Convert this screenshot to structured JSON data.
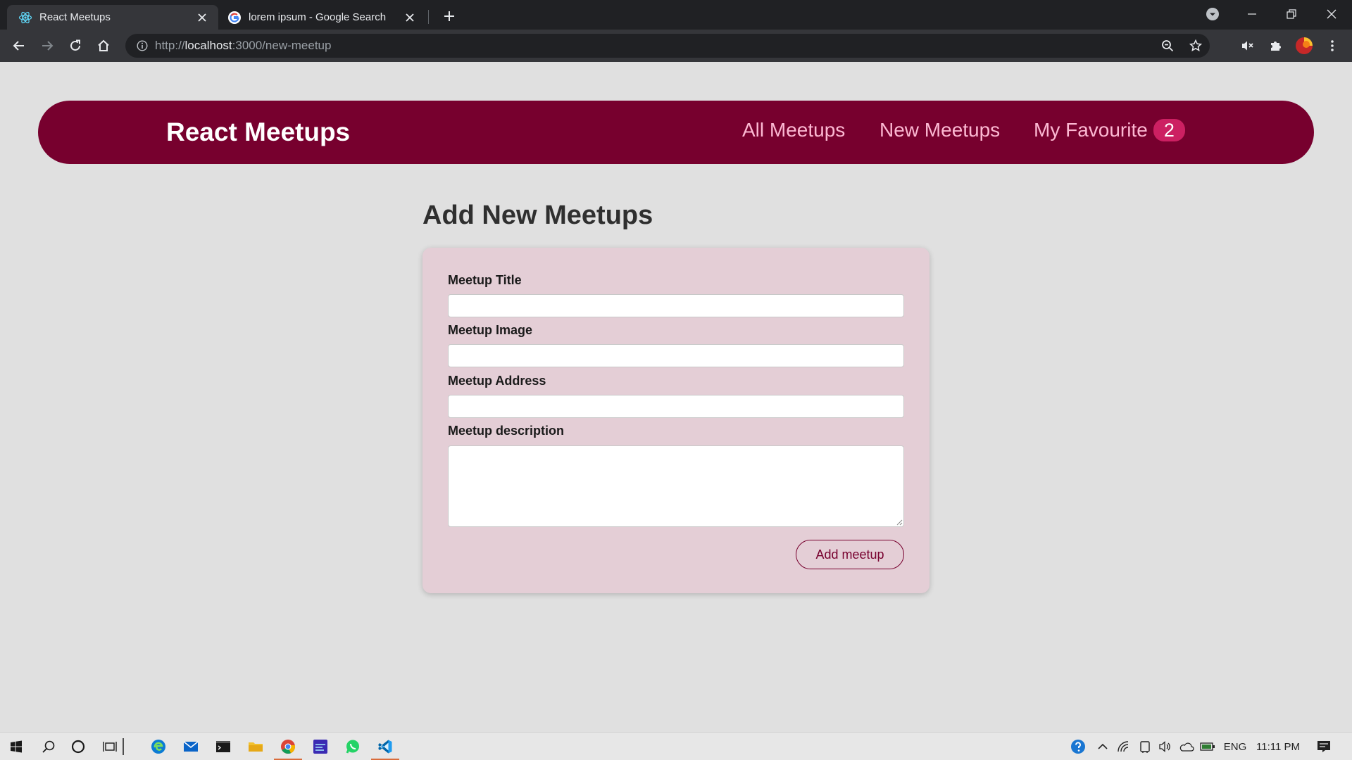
{
  "browser": {
    "tabs": [
      {
        "title": "React Meetups",
        "icon": "react-icon",
        "active": true
      },
      {
        "title": "lorem ipsum - Google Search",
        "icon": "google-icon",
        "active": false
      }
    ],
    "url_prefix": "http://",
    "url_host": "localhost",
    "url_path": ":3000/new-meetup"
  },
  "app": {
    "brand": "React Meetups",
    "nav": {
      "all": "All Meetups",
      "new": "New Meetups",
      "favourite": "My Favourite",
      "favourite_count": "2"
    },
    "page_title": "Add New Meetups",
    "form": {
      "title_label": "Meetup Title",
      "title_value": "",
      "image_label": "Meetup Image",
      "image_value": "",
      "address_label": "Meetup Address",
      "address_value": "",
      "description_label": "Meetup description",
      "description_value": "",
      "submit_label": "Add meetup"
    }
  },
  "taskbar": {
    "language": "ENG",
    "clock": "11:11 PM"
  },
  "colors": {
    "brand": "#77002e",
    "nav_link": "#fcb8d2",
    "badge": "#cc2062",
    "card": "#e4ced6",
    "page_bg": "#e0e0e0"
  }
}
